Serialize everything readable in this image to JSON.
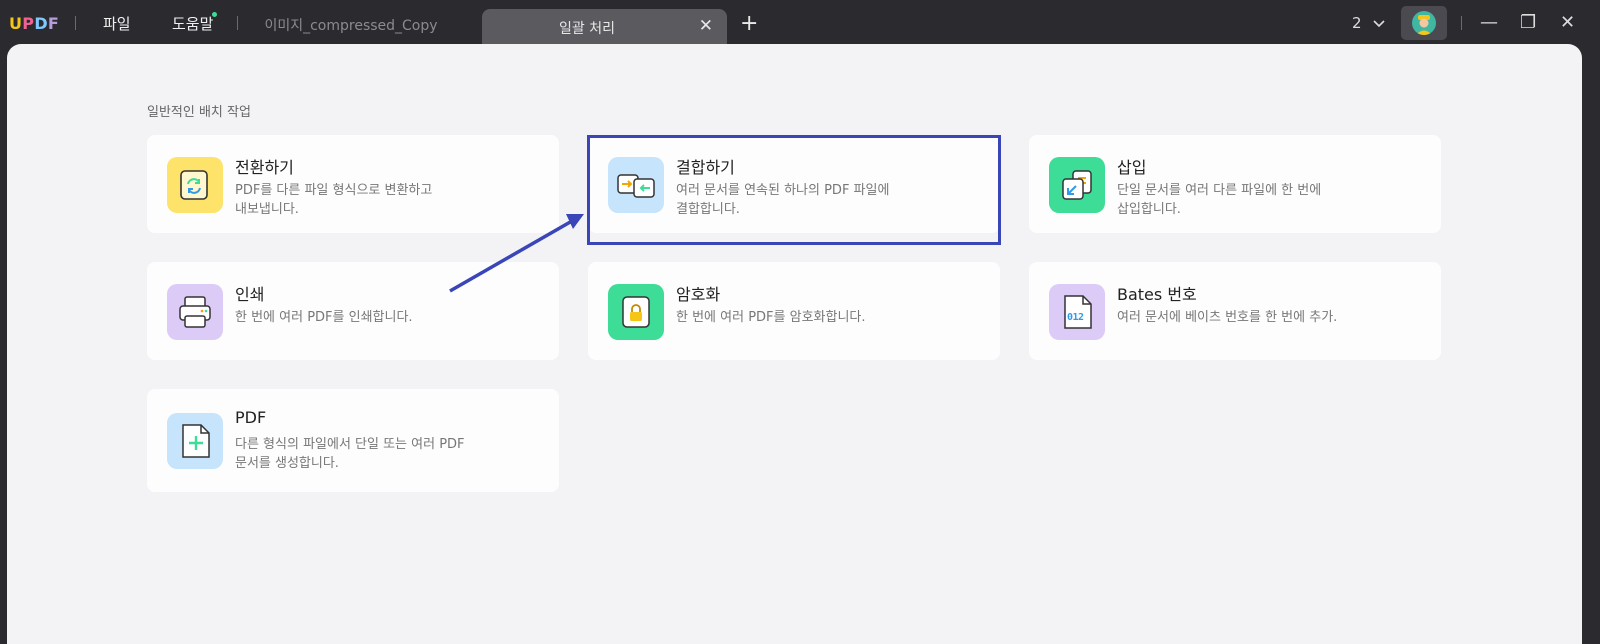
{
  "titlebar": {
    "logo": {
      "u": "U",
      "p": "P",
      "d": "D",
      "f": "F"
    },
    "menu_file": "파일",
    "menu_help": "도움말",
    "tabs": [
      {
        "label": "이미지_compressed_Copy"
      },
      {
        "label": "일괄 처리",
        "close": "✕"
      }
    ],
    "add_tab": "+",
    "window_count": "2",
    "window_count_icon": "chevron-down-icon",
    "controls": {
      "minimize": "—",
      "restore": "❐",
      "close": "✕"
    }
  },
  "main": {
    "section_title": "일반적인 배치 작업",
    "cards": [
      {
        "title": "전환하기",
        "desc": "PDF를 다른 파일 형식으로 변환하고\n내보냅니다.",
        "icon": "convert-icon",
        "icon_bg": "#fde36a"
      },
      {
        "title": "결합하기",
        "desc": "여러 문서를 연속된 하나의 PDF 파일에\n결합합니다.",
        "icon": "combine-icon",
        "icon_bg": "#c6e4fb"
      },
      {
        "title": "삽입",
        "desc": "단일 문서를 여러 다른 파일에 한 번에\n삽입합니다.",
        "icon": "insert-icon",
        "icon_bg": "#3ddc97"
      },
      {
        "title": "인쇄",
        "desc": "한 번에 여러 PDF를 인쇄합니다.",
        "icon": "print-icon",
        "icon_bg": "#dccbf7"
      },
      {
        "title": "암호화",
        "desc": "한 번에 여러 PDF를 암호화합니다.",
        "icon": "lock-icon",
        "icon_bg": "#3ddc97"
      },
      {
        "title": "Bates 번호",
        "desc": "여러 문서에 베이츠 번호를 한 번에 추가.",
        "icon": "bates-number-icon",
        "icon_bg": "#dccbf7",
        "icon_text": "012"
      },
      {
        "title": "PDF",
        "desc": "다른 형식의 파일에서 단일 또는 여러 PDF\n문서를 생성합니다.",
        "icon": "create-pdf-icon",
        "icon_bg": "#c6e4fb"
      }
    ]
  },
  "colors": {
    "accent": "#3a46b8",
    "brand_green": "#3ddc97"
  }
}
